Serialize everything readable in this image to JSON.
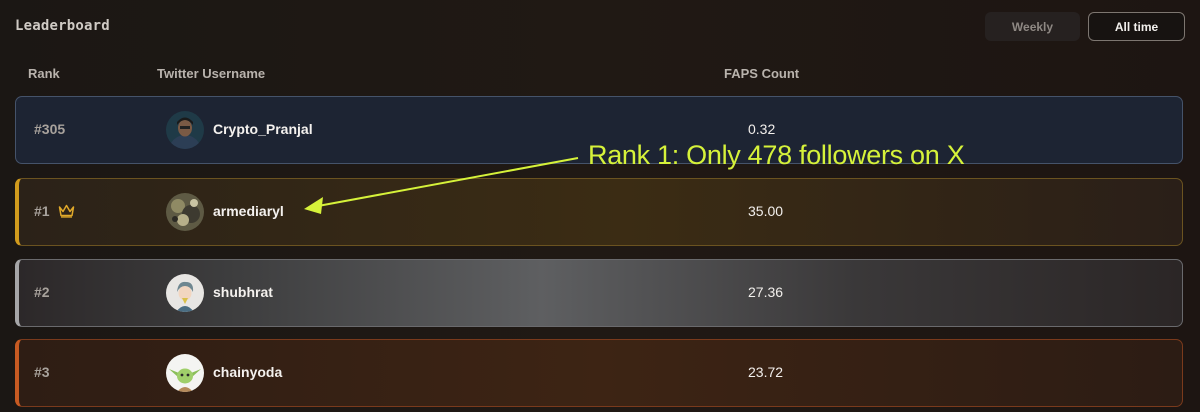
{
  "header": {
    "title": "Leaderboard",
    "toggle": {
      "weekly_label": "Weekly",
      "alltime_label": "All time",
      "selected": "All time"
    }
  },
  "columns": {
    "rank": "Rank",
    "username": "Twitter Username",
    "count": "FAPS Count"
  },
  "current_user": {
    "rank": "#305",
    "username": "Crypto_Pranjal",
    "count": "0.32",
    "avatar_icon": "user-avatar-icon"
  },
  "rows": [
    {
      "rank": "#1",
      "username": "armediaryl",
      "count": "35.00",
      "badge_icon": "crown-icon",
      "accent": "#d19b1d"
    },
    {
      "rank": "#2",
      "username": "shubhrat",
      "count": "27.36",
      "accent": "#a6a6a8"
    },
    {
      "rank": "#3",
      "username": "chainyoda",
      "count": "23.72",
      "accent": "#c75a22"
    }
  ],
  "annotation": {
    "text": "Rank 1: Only 478 followers on X",
    "color": "#d6f23a"
  }
}
